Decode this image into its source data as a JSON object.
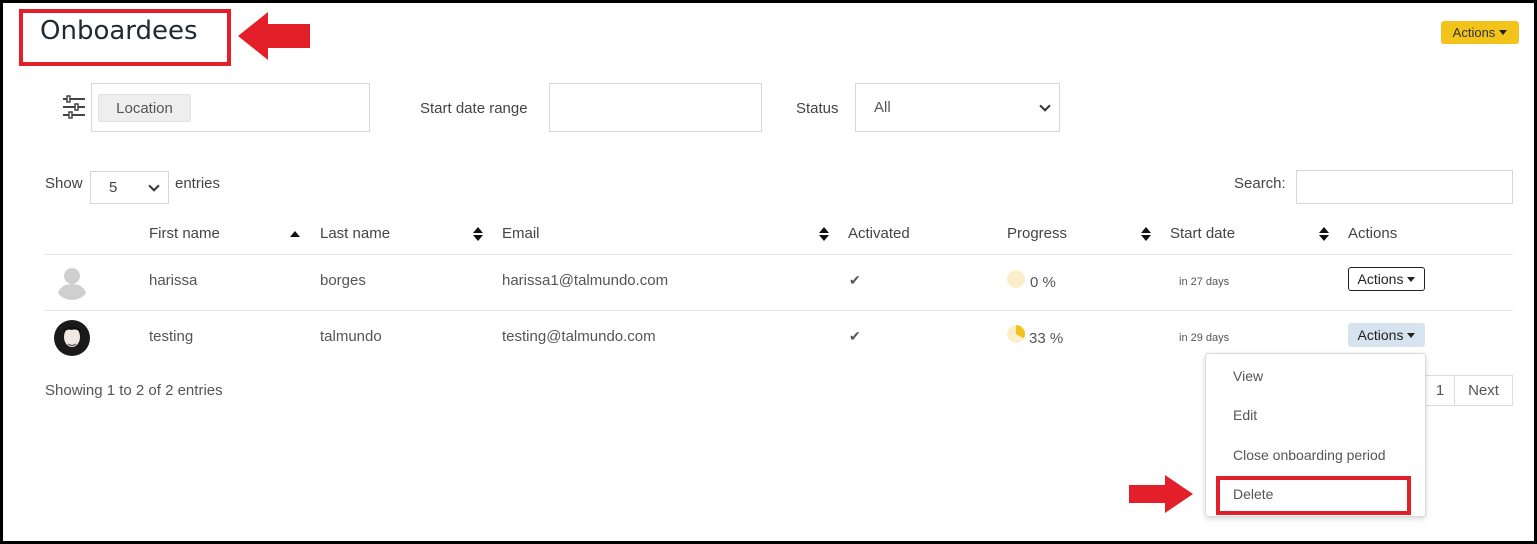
{
  "page": {
    "title": "Onboardees",
    "top_actions_label": "Actions"
  },
  "filters": {
    "location_chip": "Location",
    "start_date_label": "Start date range",
    "status_label": "Status",
    "status_value": "All"
  },
  "table_controls": {
    "show_label": "Show",
    "show_value": "5",
    "entries_label": "entries",
    "search_label": "Search:",
    "info": "Showing 1 to 2 of 2 entries"
  },
  "columns": [
    "First name",
    "Last name",
    "Email",
    "Activated",
    "Progress",
    "Start date",
    "Actions"
  ],
  "rows": [
    {
      "first_name": "harissa",
      "last_name": "borges",
      "email": "harissa1@talmundo.com",
      "activated": "✔",
      "progress": "0 %",
      "progress_value": 0,
      "start_date": "in 27 days",
      "actions_label": "Actions"
    },
    {
      "first_name": "testing",
      "last_name": "talmundo",
      "email": "testing@talmundo.com",
      "activated": "✔",
      "progress": "33 %",
      "progress_value": 0.33,
      "start_date": "in 29 days",
      "actions_label": "Actions"
    }
  ],
  "dropdown": {
    "items": [
      "View",
      "Edit",
      "Close onboarding period",
      "Delete"
    ]
  },
  "pagination": {
    "page": "1",
    "next": "Next"
  },
  "colors": {
    "accent_yellow": "#f2c31b",
    "annotation_red": "#e3202a",
    "active_actions_bg": "#d7e3ef"
  },
  "icons": [
    "filter-sliders-icon",
    "check-icon",
    "caret-down-icon",
    "chevron-down-icon",
    "sort-icon",
    "red-arrow-icon"
  ]
}
